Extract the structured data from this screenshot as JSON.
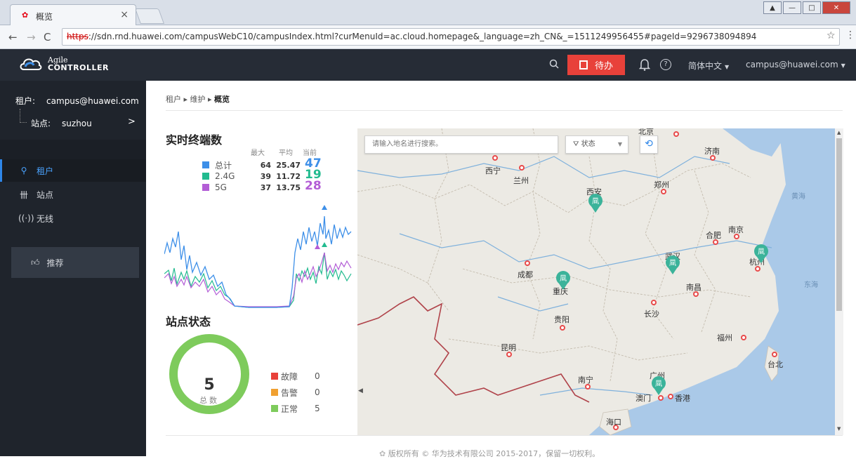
{
  "browser": {
    "tab_title": "概览",
    "url_scheme": "https",
    "url_rest": "://sdn.rnd.huawei.com/campusWebC10/campusIndex.html?curMenuId=ac.cloud.homepage&_language=zh_CN&_=1511249956455#pageId=9296738094894"
  },
  "header": {
    "brand_line1": "Agile",
    "brand_line2": "CONTROLLER",
    "todo_label": "待办",
    "language": "简体中文",
    "user": "campus@huawei.com"
  },
  "sidebar": {
    "tenant_key": "租户:",
    "tenant_value": "campus@huawei.com",
    "site_key": "站点:",
    "site_value": "suzhou",
    "site_arrow": ">",
    "items": [
      {
        "label": "租户",
        "icon": "user-icon"
      },
      {
        "label": "站点",
        "icon": "site-icon"
      },
      {
        "label": "无线",
        "icon": "wifi-icon"
      }
    ],
    "recommend": "推荐"
  },
  "breadcrumb": {
    "a": "租户",
    "b": "维护",
    "c": "概览"
  },
  "terminals": {
    "title": "实时终端数",
    "col_max": "最大",
    "col_avg": "平均",
    "col_cur": "当前",
    "rows": [
      {
        "name": "总计",
        "max": "64",
        "avg": "25.47",
        "cur": "47",
        "color": "#3d8fe8"
      },
      {
        "name": "2.4G",
        "max": "39",
        "avg": "11.72",
        "cur": "19",
        "color": "#22bb8f"
      },
      {
        "name": "5G",
        "max": "37",
        "avg": "13.75",
        "cur": "28",
        "color": "#b35ed6"
      }
    ]
  },
  "site_status": {
    "title": "站点状态",
    "total": "5",
    "total_label": "总数",
    "rows": [
      {
        "name": "故障",
        "value": "0",
        "color": "#e8413a"
      },
      {
        "name": "告警",
        "value": "0",
        "color": "#f0a030"
      },
      {
        "name": "正常",
        "value": "5",
        "color": "#7ecb5c"
      }
    ]
  },
  "map": {
    "search_placeholder": "请输入地名进行搜索。",
    "filter_label": "状态",
    "cities": [
      "北京",
      "西宁",
      "兰州",
      "济南",
      "西安",
      "郑州",
      "合肥",
      "南京",
      "武汉",
      "杭州",
      "成都",
      "重庆",
      "南昌",
      "长沙",
      "贵阳",
      "福州",
      "昆明",
      "台北",
      "南宁",
      "广州",
      "澳门",
      "香港",
      "海口"
    ],
    "seas": [
      "黄海",
      "东海"
    ]
  },
  "footer": "版权所有 © 华为技术有限公司 2015-2017，保留一切权利。"
}
